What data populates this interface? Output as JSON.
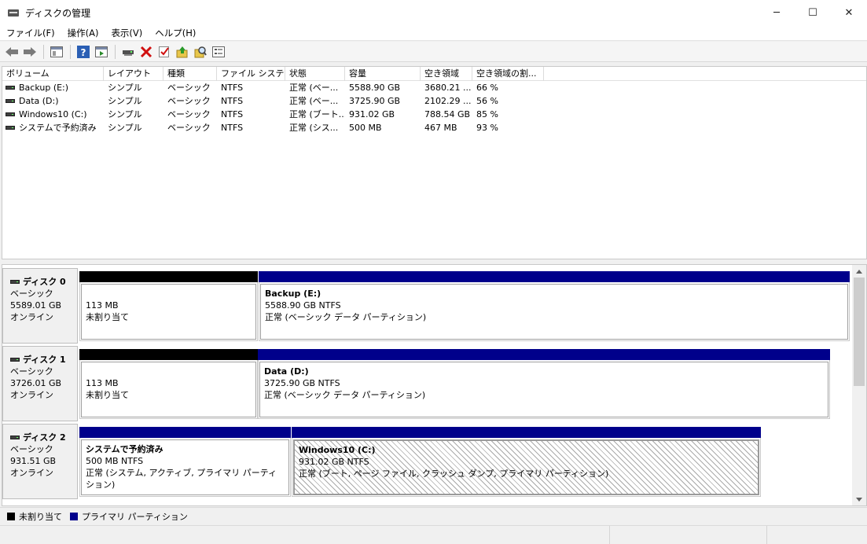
{
  "window": {
    "title": "ディスクの管理",
    "minimize": "─",
    "maximize": "☐",
    "close": "✕"
  },
  "menu": [
    "ファイル(F)",
    "操作(A)",
    "表示(V)",
    "ヘルプ(H)"
  ],
  "toolbar_icons": [
    "back-arrow-icon",
    "forward-arrow-icon",
    "console-tree-icon",
    "help-icon",
    "show-hide-icon",
    "connect-icon",
    "delete-icon",
    "check-icon",
    "rescan-icon",
    "search-icon",
    "properties-icon"
  ],
  "volumes": {
    "columns": [
      "ボリューム",
      "レイアウト",
      "種類",
      "ファイル システム",
      "状態",
      "容量",
      "空き領域",
      "空き領域の割..."
    ],
    "rows": [
      [
        "Backup (E:)",
        "シンプル",
        "ベーシック",
        "NTFS",
        "正常 (ベー...",
        "5588.90 GB",
        "3680.21 ...",
        "66 %"
      ],
      [
        "Data (D:)",
        "シンプル",
        "ベーシック",
        "NTFS",
        "正常 (ベー...",
        "3725.90 GB",
        "2102.29 ...",
        "56 %"
      ],
      [
        "Windows10 (C:)",
        "シンプル",
        "ベーシック",
        "NTFS",
        "正常 (ブート...",
        "931.02 GB",
        "788.54 GB",
        "85 %"
      ],
      [
        "システムで予約済み",
        "シンプル",
        "ベーシック",
        "NTFS",
        "正常 (シス...",
        "500 MB",
        "467 MB",
        "93 %"
      ]
    ]
  },
  "disks": [
    {
      "name": "ディスク 0",
      "type": "ベーシック",
      "size": "5589.01 GB",
      "status": "オンライン",
      "partitions": [
        {
          "name": "",
          "size": "113 MB",
          "desc": "未割り当て"
        },
        {
          "name": "Backup  (E:)",
          "size": "5588.90 GB NTFS",
          "desc": "正常 (ベーシック データ パーティション)"
        }
      ]
    },
    {
      "name": "ディスク 1",
      "type": "ベーシック",
      "size": "3726.01 GB",
      "status": "オンライン",
      "partitions": [
        {
          "name": "",
          "size": "113 MB",
          "desc": "未割り当て"
        },
        {
          "name": "Data  (D:)",
          "size": "3725.90 GB NTFS",
          "desc": "正常 (ベーシック データ パーティション)"
        }
      ]
    },
    {
      "name": "ディスク 2",
      "type": "ベーシック",
      "size": "931.51 GB",
      "status": "オンライン",
      "partitions": [
        {
          "name": "システムで予約済み",
          "size": "500 MB NTFS",
          "desc": "正常 (システム, アクティブ, プライマリ パーティション)"
        },
        {
          "name": "Windows10  (C:)",
          "size": "931.02 GB NTFS",
          "desc": "正常 (ブート, ページ ファイル, クラッシュ ダンプ, プライマリ パーティション)"
        }
      ]
    }
  ],
  "legend": [
    {
      "label": "未割り当て",
      "color": "#000000"
    },
    {
      "label": "プライマリ パーティション",
      "color": "#00008b"
    }
  ]
}
